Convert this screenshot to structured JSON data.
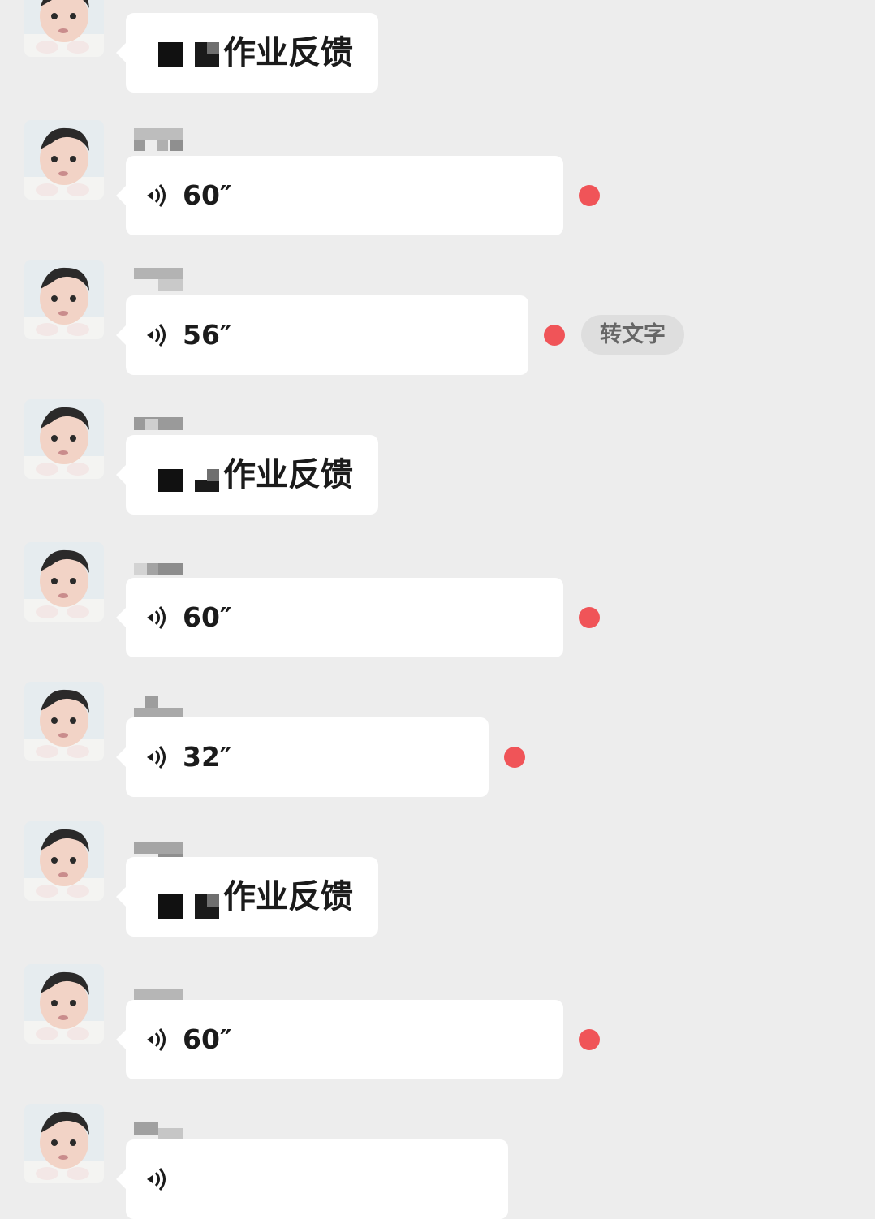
{
  "messages": [
    {
      "type": "text",
      "text": "作业反馈",
      "nick_redacted": true
    },
    {
      "type": "voice",
      "duration": "60″",
      "unread": true
    },
    {
      "type": "voice",
      "duration": "56″",
      "unread": true,
      "action": "转文字"
    },
    {
      "type": "text",
      "text": "作业反馈",
      "nick_redacted": true
    },
    {
      "type": "voice",
      "duration": "60″",
      "unread": true
    },
    {
      "type": "voice",
      "duration": "32″",
      "unread": true
    },
    {
      "type": "text",
      "text": "作业反馈",
      "nick_redacted": true
    },
    {
      "type": "voice",
      "duration": "60″",
      "unread": true
    },
    {
      "type": "voice",
      "duration": "",
      "unread": false
    }
  ],
  "colors": {
    "background": "#ededed",
    "bubble": "#ffffff",
    "unread_dot": "#f05458",
    "text": "#1b1b1b"
  },
  "icons": {
    "voice": "voice-wave-icon",
    "avatar": "baby-avatar"
  }
}
